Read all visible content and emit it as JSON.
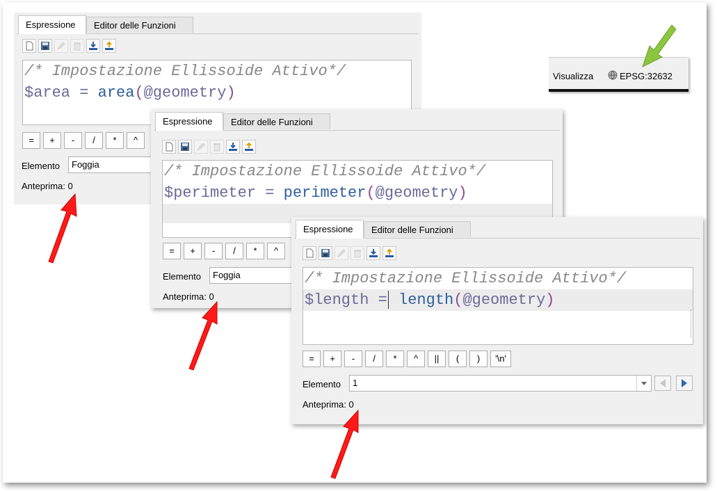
{
  "panel_area": {
    "tabs": [
      "Espressione",
      "Editor delle Funzioni"
    ],
    "editor": {
      "comment": "/* Impostazione Ellissoide Attivo*/",
      "var": "$area",
      "eq": " = ",
      "fn": "area",
      "open": "(",
      "arg": "@geometry",
      "close": ")"
    },
    "operators": [
      "=",
      "+",
      "-",
      "/",
      "*",
      "^"
    ],
    "elemento_label": "Elemento",
    "elemento_value": "Foggia",
    "anteprima_label": "Anteprima:",
    "anteprima_value": "0"
  },
  "panel_perimeter": {
    "tabs": [
      "Espressione",
      "Editor delle Funzioni"
    ],
    "editor": {
      "comment": "/* Impostazione Ellissoide Attivo*/",
      "var": "$perimeter",
      "eq": " = ",
      "fn": "perimeter",
      "open": "(",
      "arg": "@geometry",
      "close": ")"
    },
    "operators": [
      "=",
      "+",
      "-",
      "/",
      "*",
      "^"
    ],
    "elemento_label": "Elemento",
    "elemento_value": "Foggia",
    "anteprima_label": "Anteprima:",
    "anteprima_value": "0"
  },
  "panel_length": {
    "tabs": [
      "Espressione",
      "Editor delle Funzioni"
    ],
    "editor": {
      "comment": "/* Impostazione Ellissoide Attivo*/",
      "var": "$length",
      "eq1": " =",
      "eq2": " ",
      "fn": "length",
      "open": "(",
      "arg": "@geometry",
      "close": ")"
    },
    "operators": [
      "=",
      "+",
      "-",
      "/",
      "*",
      "^",
      "||",
      "(",
      ")",
      "'\\n'"
    ],
    "elemento_label": "Elemento",
    "elemento_value": "1",
    "anteprima_label": "Anteprima:",
    "anteprima_value": "0"
  },
  "statusbar": {
    "view_label": "Visualizza",
    "crs": "EPSG:32632"
  },
  "colors": {
    "arrow_red": "#ff1a1a",
    "arrow_green": "#8cc63f"
  },
  "icons": [
    "new-file-icon",
    "save-icon",
    "edit-icon",
    "delete-icon",
    "import-icon",
    "export-icon",
    "globe-icon",
    "arrow-left-icon",
    "arrow-right-icon"
  ]
}
